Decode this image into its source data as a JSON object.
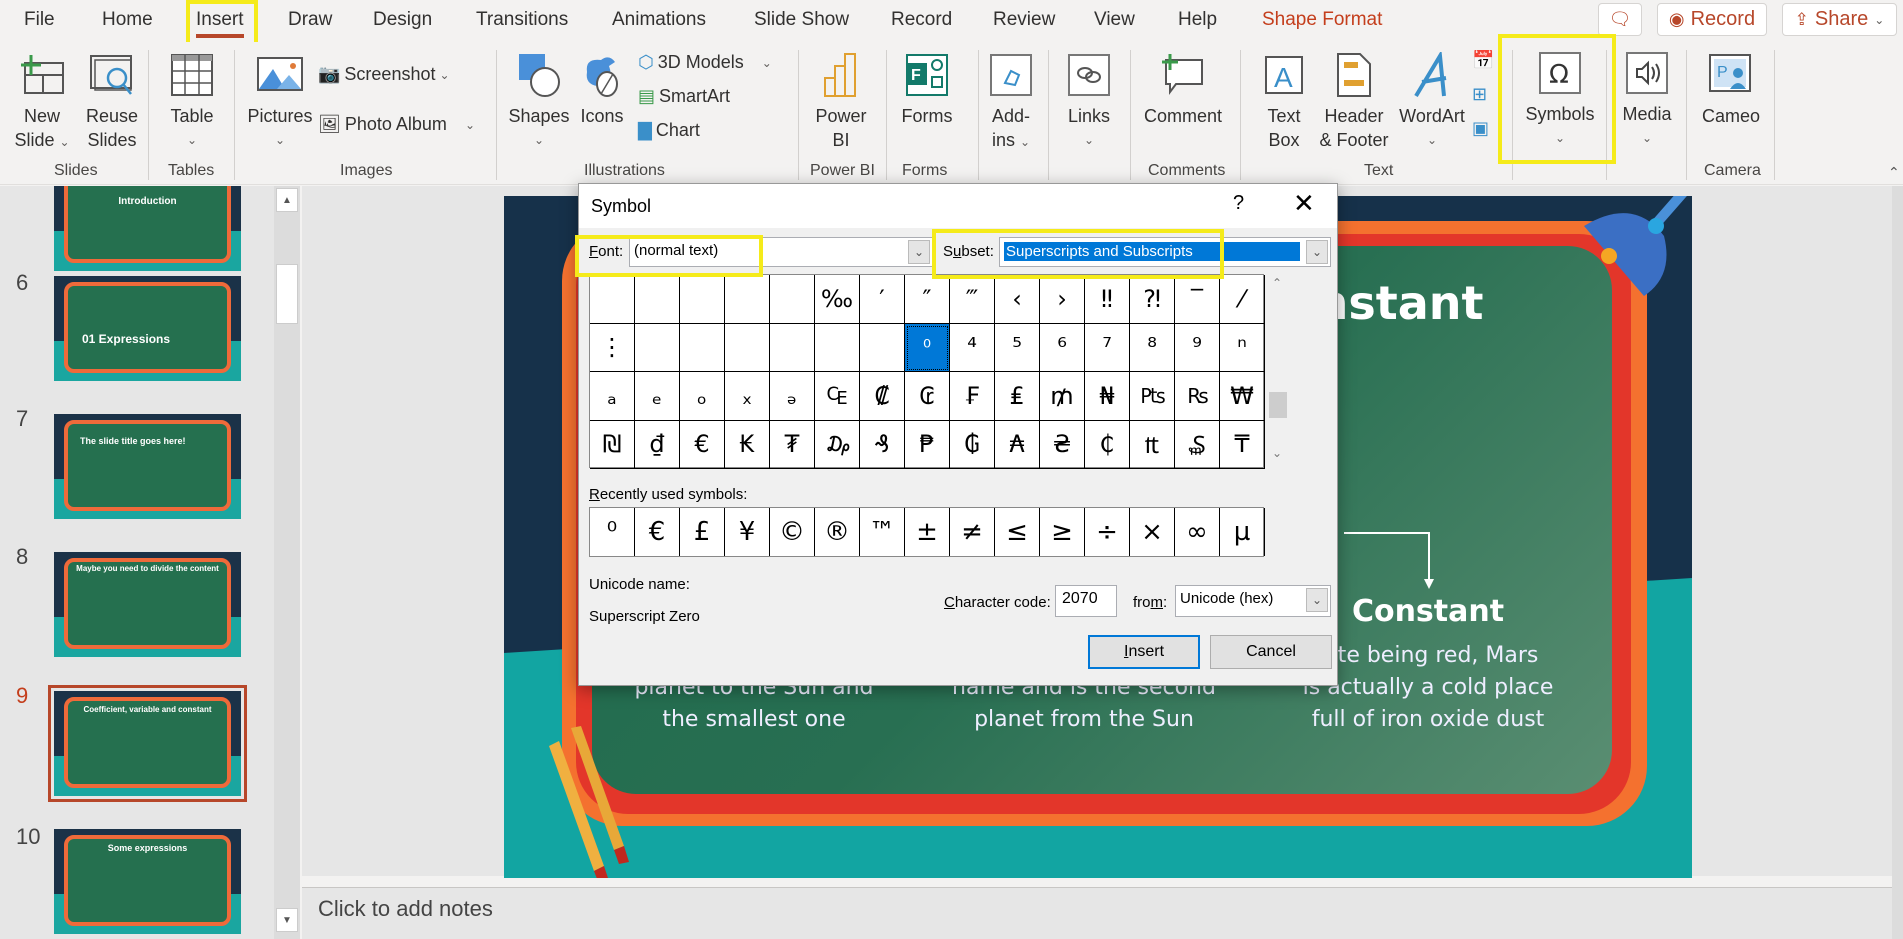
{
  "menu": {
    "tabs": [
      "File",
      "Home",
      "Insert",
      "Draw",
      "Design",
      "Transitions",
      "Animations",
      "Slide Show",
      "Record",
      "Review",
      "View",
      "Help",
      "Shape Format"
    ],
    "active_tab": "Insert",
    "comments_icon": "comment-icon",
    "record_label": "Record",
    "share_label": "Share"
  },
  "ribbon": {
    "slides": {
      "new_slide": [
        "New",
        "Slide"
      ],
      "reuse_slides": [
        "Reuse",
        "Slides"
      ],
      "group": "Slides"
    },
    "tables": {
      "table": "Table",
      "group": "Tables"
    },
    "images": {
      "pictures": "Pictures",
      "screenshot": "Screenshot",
      "photo_album": "Photo Album",
      "group": "Images"
    },
    "illustrations": {
      "shapes": "Shapes",
      "icons": "Icons",
      "models3d": "3D Models",
      "smartart": "SmartArt",
      "chart": "Chart",
      "group": "Illustrations"
    },
    "powerbi": {
      "label": [
        "Power",
        "BI"
      ],
      "group": "Power BI"
    },
    "forms": {
      "label": "Forms",
      "group": "Forms"
    },
    "addins": {
      "label": [
        "Add-",
        "ins"
      ]
    },
    "links": {
      "label": "Links"
    },
    "comments": {
      "label": "Comment",
      "group": "Comments"
    },
    "text": {
      "text_box": [
        "Text",
        "Box"
      ],
      "header_footer": [
        "Header",
        "& Footer"
      ],
      "wordart": "WordArt",
      "group": "Text"
    },
    "symbols": {
      "label": "Symbols"
    },
    "media": {
      "label": "Media"
    },
    "camera": {
      "cameo": "Cameo",
      "group": "Camera"
    }
  },
  "thumbnails": [
    {
      "number": "",
      "title": "Introduction",
      "partial": true
    },
    {
      "number": "6",
      "title": "01 Expressions"
    },
    {
      "number": "7",
      "title": "The slide title goes here!"
    },
    {
      "number": "8",
      "title": "Maybe you need to divide the content"
    },
    {
      "number": "9",
      "title": "Coefficient, variable and constant",
      "selected": true
    },
    {
      "number": "10",
      "title": "Some expressions"
    }
  ],
  "slide": {
    "title_fragment": "onstant",
    "columns": [
      {
        "heading": "",
        "text": [
          "planet to the Sun and",
          "the smallest one"
        ]
      },
      {
        "heading": "",
        "text": [
          "name and is the second",
          "planet from the Sun"
        ]
      },
      {
        "heading": "Constant",
        "text": [
          "pite being red, Mars",
          "is actually a cold place",
          "full of iron oxide dust"
        ]
      }
    ]
  },
  "notes": {
    "placeholder": "Click to add notes"
  },
  "dialog": {
    "title": "Symbol",
    "help": "?",
    "font_label": "Font:",
    "font_value": "(normal text)",
    "subset_label": "Subset:",
    "subset_value": "Superscripts and Subscripts",
    "grid": [
      [
        "",
        "",
        "",
        "",
        "",
        "‰",
        "′",
        "″",
        "‴",
        "‹",
        "›",
        "‼",
        "⁈",
        "‾",
        "⁄"
      ],
      [
        "⋮",
        "",
        "",
        "",
        "",
        "",
        "",
        "⁰",
        "⁴",
        "⁵",
        "⁶",
        "⁷",
        "⁸",
        "⁹",
        "ⁿ"
      ],
      [
        "ₐ",
        "ₑ",
        "ₒ",
        "ₓ",
        "ₔ",
        "₠",
        "₡",
        "₢",
        "₣",
        "₤",
        "₥",
        "₦",
        "₧",
        "₨",
        "₩"
      ],
      [
        "₪",
        "₫",
        "€",
        "₭",
        "₮",
        "₯",
        "₰",
        "₱",
        "₲",
        "₳",
        "₴",
        "₵",
        "₶",
        "₷",
        "₸"
      ]
    ],
    "selected_cell": "⁰",
    "recent_label": "Recently used symbols:",
    "recent": [
      "⁰",
      "€",
      "£",
      "¥",
      "©",
      "®",
      "™",
      "±",
      "≠",
      "≤",
      "≥",
      "÷",
      "×",
      "∞",
      "µ"
    ],
    "unicode_name_label": "Unicode name:",
    "unicode_name": "Superscript Zero",
    "char_code_label": "Character code:",
    "char_code": "2070",
    "from_label": "from:",
    "from_value": "Unicode (hex)",
    "insert_label": "Insert",
    "cancel_label": "Cancel"
  },
  "colors": {
    "accent": "#b7472a",
    "highlight": "#f5eb1a",
    "selection": "#0078d7"
  }
}
